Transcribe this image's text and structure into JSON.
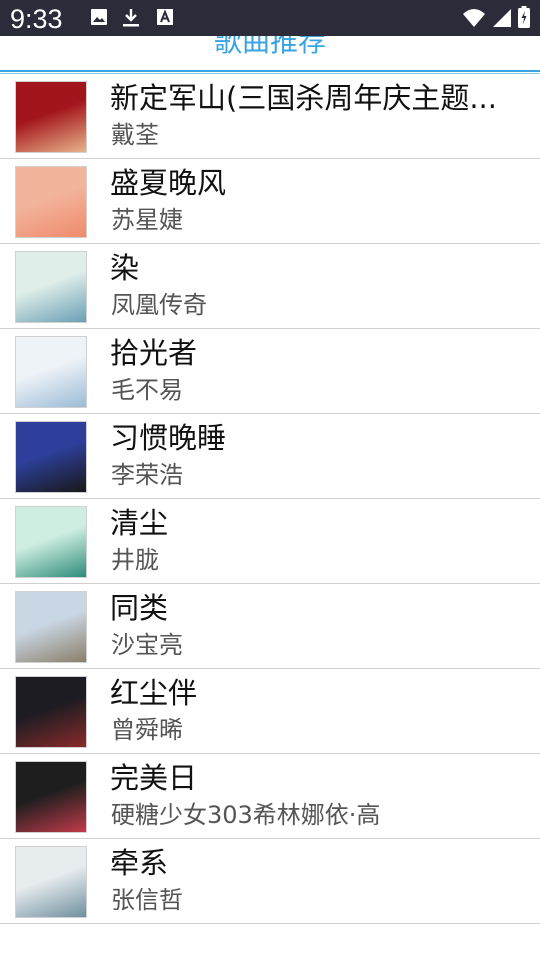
{
  "status_bar": {
    "time": "9:33",
    "left_icons": [
      "image-icon",
      "download-icon",
      "a-font-icon"
    ],
    "right_icons": [
      "wifi-icon",
      "signal-icon",
      "battery-icon"
    ]
  },
  "header": {
    "title": "歌曲推荐",
    "accent_color": "#3aa3e3"
  },
  "songs": [
    {
      "title": "新定军山(三国杀周年庆主题...",
      "artist": "戴荃",
      "cover_colors": [
        "#a3151c",
        "#e8b48a"
      ]
    },
    {
      "title": "盛夏晚风",
      "artist": "苏星婕",
      "cover_colors": [
        "#f2b49a",
        "#f08a6c"
      ]
    },
    {
      "title": "染",
      "artist": "凤凰传奇",
      "cover_colors": [
        "#dfeee9",
        "#6a9fb5"
      ]
    },
    {
      "title": "拾光者",
      "artist": "毛不易",
      "cover_colors": [
        "#eef3f8",
        "#9bbbd6"
      ]
    },
    {
      "title": "习惯晚睡",
      "artist": "李荣浩",
      "cover_colors": [
        "#2d3f9a",
        "#181818"
      ]
    },
    {
      "title": "清尘",
      "artist": "井胧",
      "cover_colors": [
        "#cfeee2",
        "#2f8c7a"
      ]
    },
    {
      "title": "同类",
      "artist": "沙宝亮",
      "cover_colors": [
        "#c9d6e3",
        "#8a7f6a"
      ]
    },
    {
      "title": "红尘伴",
      "artist": "曾舜晞",
      "cover_colors": [
        "#1c1c22",
        "#8a2a2a"
      ]
    },
    {
      "title": "完美日",
      "artist": "硬糖少女303希林娜依·高",
      "cover_colors": [
        "#1e1e1e",
        "#c23a4a"
      ]
    },
    {
      "title": "牵系",
      "artist": "张信哲",
      "cover_colors": [
        "#e7ecef",
        "#6f8f9e"
      ]
    }
  ]
}
